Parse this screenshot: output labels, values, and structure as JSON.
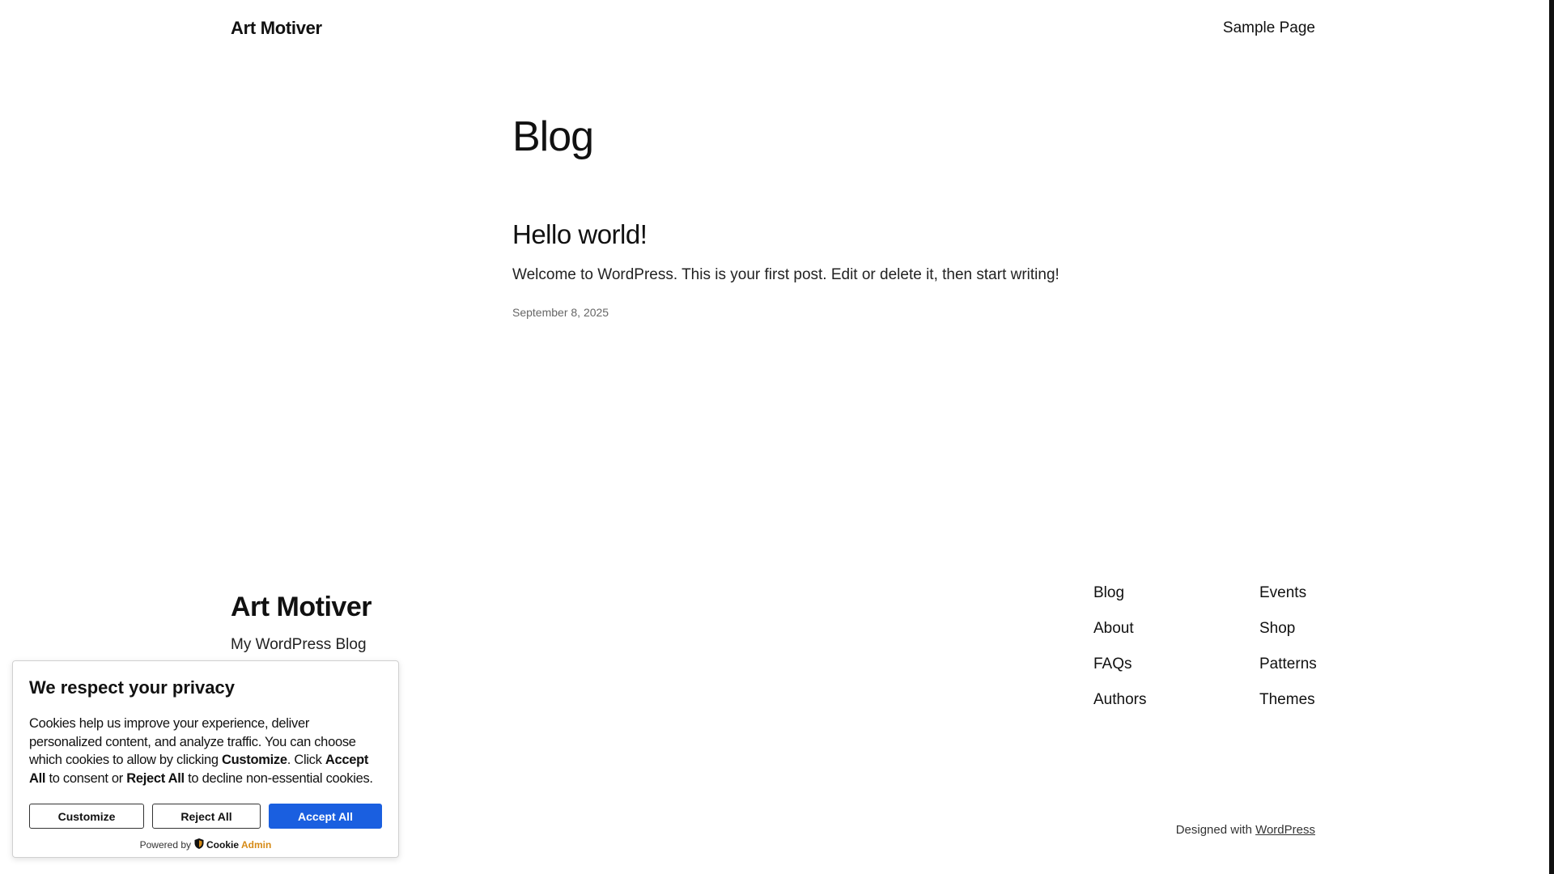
{
  "header": {
    "site_title": "Art Motiver",
    "nav_link": "Sample Page"
  },
  "main": {
    "page_title": "Blog",
    "post": {
      "title": "Hello world!",
      "excerpt": "Welcome to WordPress. This is your first post. Edit or delete it, then start writing!",
      "date": "September 8, 2025"
    }
  },
  "footer": {
    "site_title": "Art Motiver",
    "tagline": "My WordPress Blog",
    "nav": [
      "Blog",
      "Events",
      "About",
      "Shop",
      "FAQs",
      "Patterns",
      "Authors",
      "Themes"
    ],
    "credits_prefix": "Designed with",
    "credits_link": "WordPress"
  },
  "cookie_banner": {
    "title": "We respect your privacy",
    "text_1": "Cookies help us improve your experience, deliver personalized content, and analyze traffic. You can choose which cookies to allow by clicking ",
    "text_customize": "Customize",
    "text_2": ". Click ",
    "text_accept": "Accept All",
    "text_3": " to consent or ",
    "text_reject": "Reject All",
    "text_4": " to decline non-essential cookies.",
    "buttons": {
      "customize": "Customize",
      "reject": "Reject All",
      "accept": "Accept All"
    },
    "powered_by": "Powered by",
    "brand_part1": "Cookie",
    "brand_part2": "Admin",
    "accent_color": "#1a5fe0",
    "brand_icon": "shield-icon"
  }
}
